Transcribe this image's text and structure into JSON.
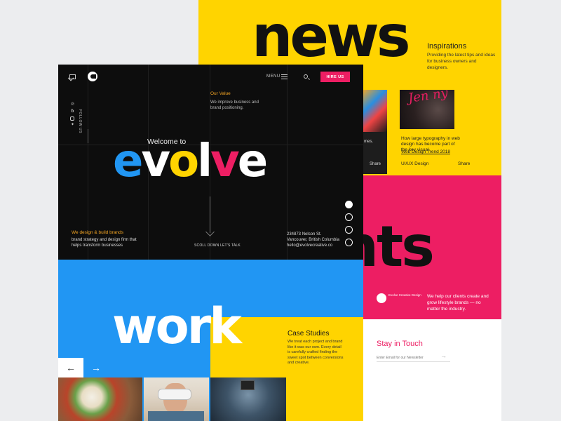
{
  "colors": {
    "yellow": "#ffd400",
    "pink": "#ed1e63",
    "blue": "#2196f3",
    "orange": "#f5a623",
    "dark": "#0d0d0d"
  },
  "back": {
    "news_heading": "news",
    "inspirations": {
      "title": "Inspirations",
      "desc": "Providing the latest tips and ideas for business owners and designers."
    },
    "card1": {
      "text": "mes.",
      "share": "Share"
    },
    "card2": {
      "text": "How large typography in web design has become part of the key visual.",
      "link": "Web Design Trend 2018",
      "category": "UI/UX Design",
      "share": "Share"
    },
    "jenny": "Jen ny",
    "clients_heading": "nts",
    "clients_desc": "We help our clients create and grow lifestyle brands — no matter the industry.",
    "mini_logo_text": "Evolve Creative Design",
    "stay_in_touch": "Stay in Touch",
    "newsletter_placeholder": "Enter Email for our Newsletter"
  },
  "hero": {
    "menu_label": "MENU",
    "hire_label": "HIRE US",
    "follow_label": "FOLLOW US",
    "social_icons": [
      "pinterest-icon",
      "behance-icon",
      "instagram-icon",
      "twitter-icon"
    ],
    "value_title": "Our Value",
    "value_desc": "We improve business and brand positioning.",
    "welcome": "Welcome to",
    "evolve_letters": [
      {
        "ch": "e",
        "color": "#2196f3"
      },
      {
        "ch": "v",
        "color": "#ffffff"
      },
      {
        "ch": "o",
        "color": "#ffd400"
      },
      {
        "ch": "l",
        "color": "#ffffff"
      },
      {
        "ch": "v",
        "color": "#ed1e63"
      },
      {
        "ch": "e",
        "color": "#ffffff"
      }
    ],
    "slide_dots": [
      true,
      false,
      false,
      false
    ],
    "scroll_label": "SCOLL DOWN LET'S TALK",
    "brands_title": "We design & build brands",
    "brands_desc": "brand strategy and design firm that helps transform businesses",
    "address": "234873 Nelson St.\nVancouver, British Columbia\nhello@evolvecreative.co"
  },
  "work": {
    "heading": "work",
    "case_title": "Case Studies",
    "case_desc": "We treat each project and brand like it was our own. Every detail is carefully crafted finding the sweet spot between conversions and creative.",
    "prev_arrow": "←",
    "next_arrow": "→"
  }
}
